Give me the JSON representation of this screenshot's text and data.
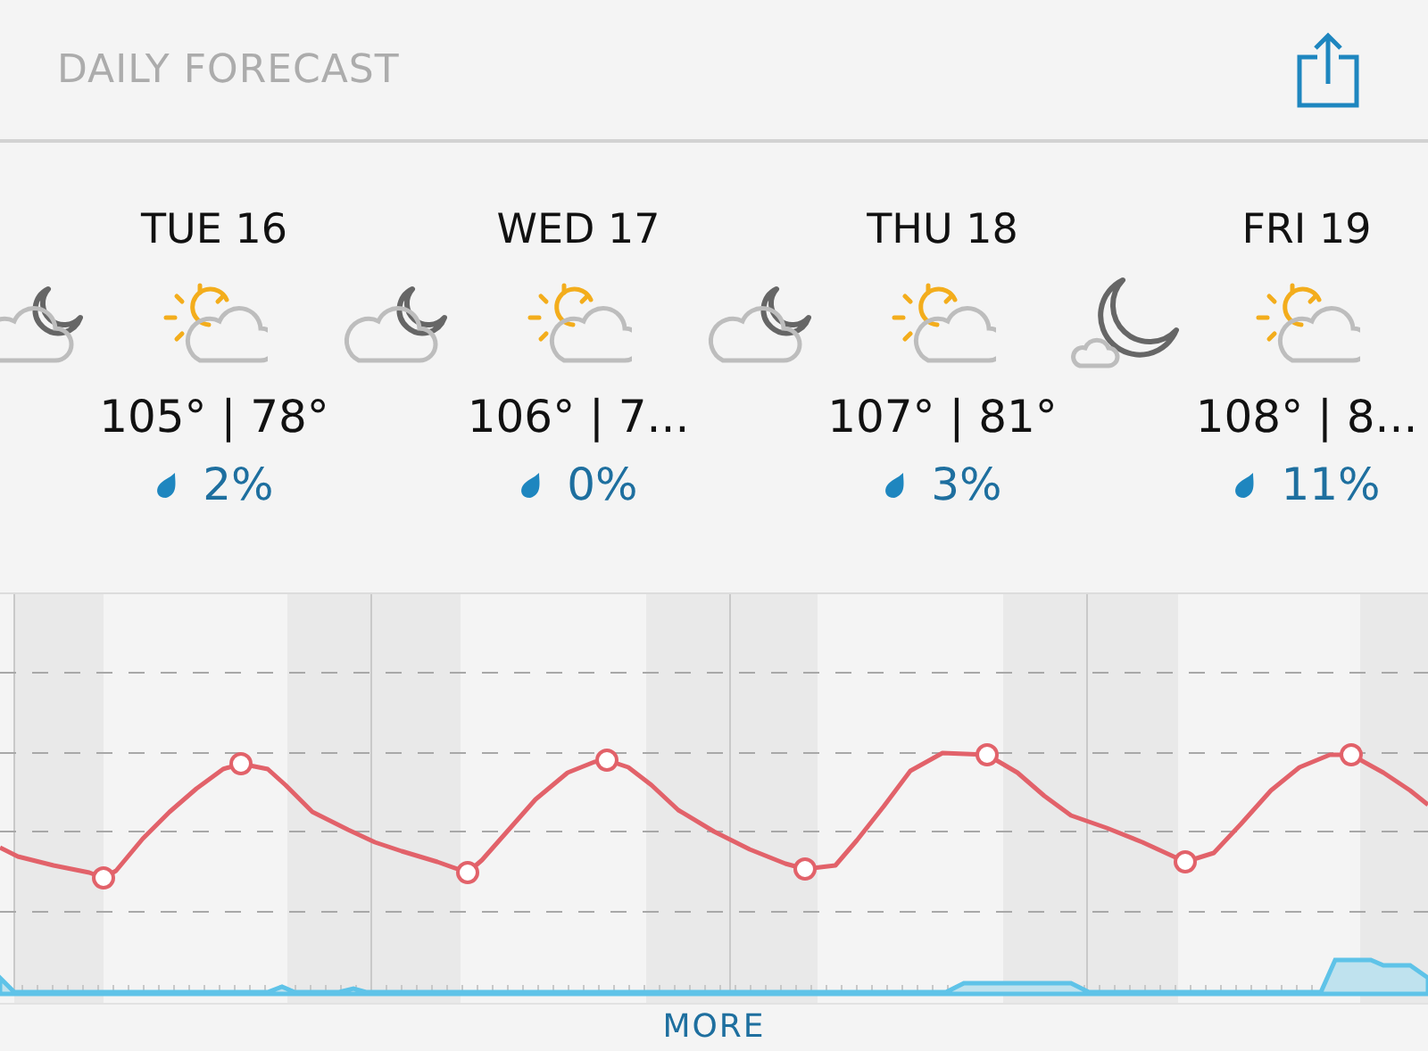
{
  "header": {
    "title": "DAILY FORECAST"
  },
  "days": [
    {
      "night_icon": {
        "kind": "partly_cloudy_night"
      },
      "label": "TUE 16",
      "day_icon": {
        "kind": "partly_sunny"
      },
      "temps": "105° | 78°",
      "precip": "2%"
    },
    {
      "night_icon": {
        "kind": "partly_cloudy_night"
      },
      "label": "WED 17",
      "day_icon": {
        "kind": "partly_sunny"
      },
      "temps": "106° | 7...",
      "precip": "0%"
    },
    {
      "night_icon": {
        "kind": "partly_cloudy_night"
      },
      "label": "THU 18",
      "day_icon": {
        "kind": "partly_sunny"
      },
      "temps": "107° | 81°",
      "precip": "3%"
    },
    {
      "night_icon": {
        "kind": "mostly_clear_night"
      },
      "label": "FRI 19",
      "day_icon": {
        "kind": "partly_sunny"
      },
      "temps": "108° | 8...",
      "precip": "11%"
    }
  ],
  "footer": {
    "button": "MORE"
  }
}
